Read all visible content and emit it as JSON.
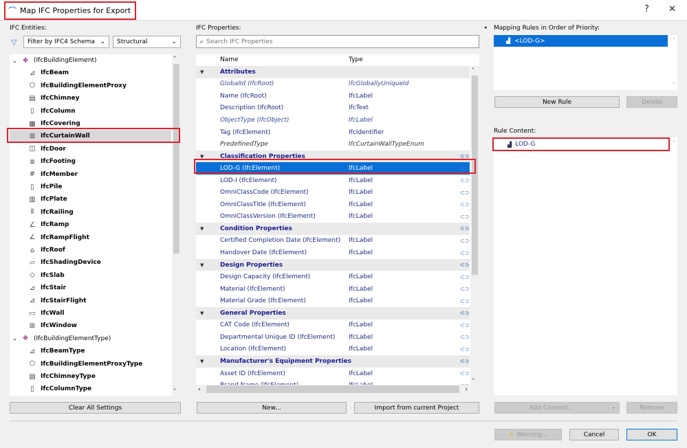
{
  "window": {
    "title": "Map IFC Properties for Export",
    "help": "?",
    "close": "✕"
  },
  "left": {
    "label": "IFC Entities:",
    "filter_value": "Filter by IFC4 Schema",
    "category_value": "Structural",
    "items": [
      {
        "label": "(IfcBuildingElement)",
        "icon": "building-element-icon",
        "glyph": "❖",
        "group": true
      },
      {
        "label": "IfcBeam",
        "icon": "beam-icon",
        "glyph": "⊿"
      },
      {
        "label": "IfcBuildingElementProxy",
        "icon": "proxy-icon",
        "glyph": "⬠"
      },
      {
        "label": "IfcChimney",
        "icon": "chimney-icon",
        "glyph": "▤"
      },
      {
        "label": "IfcColumn",
        "icon": "column-icon",
        "glyph": "▯"
      },
      {
        "label": "IfcCovering",
        "icon": "covering-icon",
        "glyph": "▦"
      },
      {
        "label": "IfcCurtainWall",
        "icon": "curtain-wall-icon",
        "glyph": "⊞",
        "selected": true
      },
      {
        "label": "IfcDoor",
        "icon": "door-icon",
        "glyph": "◫"
      },
      {
        "label": "IfcFooting",
        "icon": "footing-icon",
        "glyph": "⧈"
      },
      {
        "label": "IfcMember",
        "icon": "member-icon",
        "glyph": "#"
      },
      {
        "label": "IfcPile",
        "icon": "pile-icon",
        "glyph": "▯"
      },
      {
        "label": "IfcPlate",
        "icon": "plate-icon",
        "glyph": "▥"
      },
      {
        "label": "IfcRailing",
        "icon": "railing-icon",
        "glyph": "⫴"
      },
      {
        "label": "IfcRamp",
        "icon": "ramp-icon",
        "glyph": "∠"
      },
      {
        "label": "IfcRampFlight",
        "icon": "ramp-flight-icon",
        "glyph": "∠"
      },
      {
        "label": "IfcRoof",
        "icon": "roof-icon",
        "glyph": "⌂"
      },
      {
        "label": "IfcShadingDevice",
        "icon": "shading-device-icon",
        "glyph": "▱"
      },
      {
        "label": "IfcSlab",
        "icon": "slab-icon",
        "glyph": "◇"
      },
      {
        "label": "IfcStair",
        "icon": "stair-icon",
        "glyph": "⊿"
      },
      {
        "label": "IfcStairFlight",
        "icon": "stair-flight-icon",
        "glyph": "⊿"
      },
      {
        "label": "IfcWall",
        "icon": "wall-icon",
        "glyph": "▭"
      },
      {
        "label": "IfcWindow",
        "icon": "window-icon",
        "glyph": "⊞"
      },
      {
        "label": "(IfcBuildingElementType)",
        "icon": "building-element-type-icon",
        "glyph": "❖",
        "group": true
      },
      {
        "label": "IfcBeamType",
        "icon": "beam-icon",
        "glyph": "⊿"
      },
      {
        "label": "IfcBuildingElementProxyType",
        "icon": "proxy-icon",
        "glyph": "⬠"
      },
      {
        "label": "IfcChimneyType",
        "icon": "chimney-icon",
        "glyph": "▤"
      },
      {
        "label": "IfcColumnType",
        "icon": "column-icon",
        "glyph": "▯"
      }
    ],
    "clear_button": "Clear All Settings"
  },
  "middle": {
    "label": "IFC Properties:",
    "search_placeholder": "Search IFC Properties",
    "col_name": "Name",
    "col_type": "Type",
    "rows": [
      {
        "kind": "grp",
        "name": "Attributes"
      },
      {
        "kind": "it",
        "name": "GlobalId (IfcRoot)",
        "type": "IfcGloballyUniqueId"
      },
      {
        "kind": "n",
        "name": "Name (IfcRoot)",
        "type": "IfcLabel"
      },
      {
        "kind": "n",
        "name": "Description (IfcRoot)",
        "type": "IfcText"
      },
      {
        "kind": "it",
        "name": "ObjectType (IfcObject)",
        "type": "IfcLabel"
      },
      {
        "kind": "n",
        "name": "Tag (IfcElement)",
        "type": "IfcIdentifier"
      },
      {
        "kind": "pre",
        "name": "PredefinedType",
        "type": "IfcCurtainWallTypeEnum"
      },
      {
        "kind": "grp",
        "name": "Classification Properties",
        "link": true
      },
      {
        "kind": "sel",
        "name": "LOD-G (IfcElement)",
        "type": "IfcLabel",
        "link": true
      },
      {
        "kind": "n",
        "name": "LOD-I (IfcElement)",
        "type": "IfcLabel",
        "link": true
      },
      {
        "kind": "n",
        "name": "OmniClassCode (IfcElement)",
        "type": "IfcLabel",
        "link": true
      },
      {
        "kind": "n",
        "name": "OmniClassTitle (IfcElement)",
        "type": "IfcLabel",
        "link": true
      },
      {
        "kind": "n",
        "name": "OmniClassVersion (IfcElement)",
        "type": "IfcLabel",
        "link": true
      },
      {
        "kind": "grp",
        "name": "Condition Properties",
        "link": true
      },
      {
        "kind": "n",
        "name": "Certified Completion Date (IfcElement)",
        "type": "IfcLabel",
        "link": true
      },
      {
        "kind": "n",
        "name": "Handover Date (IfcElement)",
        "type": "IfcLabel",
        "link": true
      },
      {
        "kind": "grp",
        "name": "Design Properties",
        "link": true
      },
      {
        "kind": "n",
        "name": "Design Capacity (IfcElement)",
        "type": "IfcLabel",
        "link": true
      },
      {
        "kind": "n",
        "name": "Material (IfcElement)",
        "type": "IfcLabel",
        "link": true
      },
      {
        "kind": "n",
        "name": "Material Grade (IfcElement)",
        "type": "IfcLabel",
        "link": true
      },
      {
        "kind": "grp",
        "name": "General Properties",
        "link": true
      },
      {
        "kind": "n",
        "name": "CAT Code (IfcElement)",
        "type": "IfcLabel",
        "link": true
      },
      {
        "kind": "n",
        "name": "Departmental Unique ID (IfcElement)",
        "type": "IfcLabel",
        "link": true
      },
      {
        "kind": "n",
        "name": "Location (IfcElement)",
        "type": "IfcLabel",
        "link": true
      },
      {
        "kind": "grp",
        "name": "Manufacturer's Equipment Properties",
        "link": true
      },
      {
        "kind": "n",
        "name": "Asset ID (IfcElement)",
        "type": "IfcLabel",
        "link": true
      },
      {
        "kind": "n",
        "name": "Brand Name (IfcElement)",
        "type": "IfcLabel",
        "link": true
      }
    ],
    "new_button": "New...",
    "import_button": "Import from current Project"
  },
  "right": {
    "rules_label": "Mapping Rules in Order of Priority:",
    "rules": [
      "<LOD-G>"
    ],
    "new_rule": "New Rule",
    "delete": "Delete",
    "content_label": "Rule Content:",
    "content": [
      "LOD-G"
    ],
    "add_content": "Add Content...",
    "remove": "Remove"
  },
  "footer": {
    "warning": "Warning...",
    "cancel": "Cancel",
    "ok": "OK"
  },
  "colors": {
    "selection": "#0a6fd6",
    "highlight": "#e0202a"
  }
}
